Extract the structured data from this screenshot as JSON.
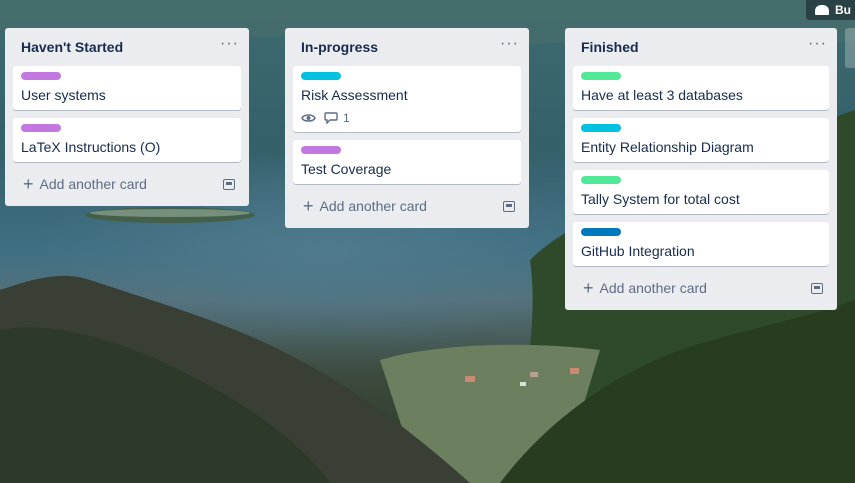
{
  "header": {
    "button_label": "Bu"
  },
  "lists": [
    {
      "title": "Haven't Started",
      "cards": [
        {
          "label_color": "#c377e0",
          "title": "User systems"
        },
        {
          "label_color": "#c377e0",
          "title": "LaTeX Instructions (O)"
        }
      ],
      "add_card_label": "Add another card"
    },
    {
      "title": "In-progress",
      "cards": [
        {
          "label_color": "#00c2e0",
          "title": "Risk Assessment",
          "comments": "1"
        },
        {
          "label_color": "#c377e0",
          "title": "Test Coverage"
        }
      ],
      "add_card_label": "Add another card"
    },
    {
      "title": "Finished",
      "cards": [
        {
          "label_color": "#51e898",
          "title": "Have at least 3 databases"
        },
        {
          "label_color": "#00c2e0",
          "title": "Entity Relationship Diagram"
        },
        {
          "label_color": "#51e898",
          "title": "Tally System for total cost"
        },
        {
          "label_color": "#0079bf",
          "title": "GitHub Integration"
        }
      ],
      "add_card_label": "Add another card"
    }
  ]
}
